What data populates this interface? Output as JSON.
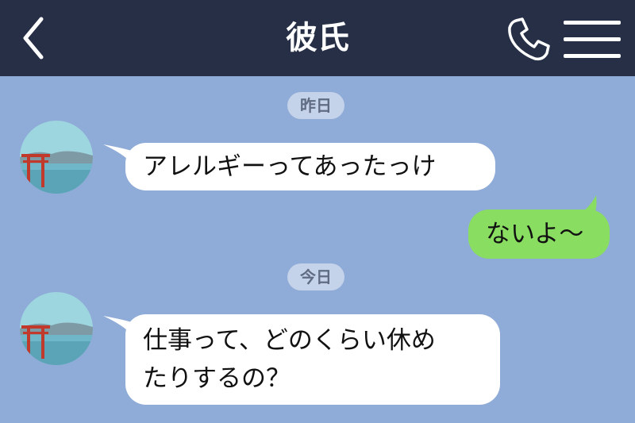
{
  "header": {
    "title": "彼氏",
    "back_icon": "chevron-left-icon",
    "call_icon": "phone-icon",
    "menu_icon": "hamburger-menu-icon"
  },
  "colors": {
    "header_bg": "#262f45",
    "chat_bg": "#8fabd8",
    "incoming_bubble": "#ffffff",
    "outgoing_bubble": "#89dd61",
    "date_pill": "#c4d2ea"
  },
  "messages": [
    {
      "type": "date",
      "text": "昨日"
    },
    {
      "type": "incoming",
      "sender": "彼氏",
      "text": "アレルギーってあったっけ"
    },
    {
      "type": "outgoing",
      "text": "ないよ〜"
    },
    {
      "type": "date",
      "text": "今日"
    },
    {
      "type": "incoming",
      "sender": "彼氏",
      "lines": [
        "仕事って、どのくらい休め",
        "たりするの？"
      ]
    }
  ]
}
